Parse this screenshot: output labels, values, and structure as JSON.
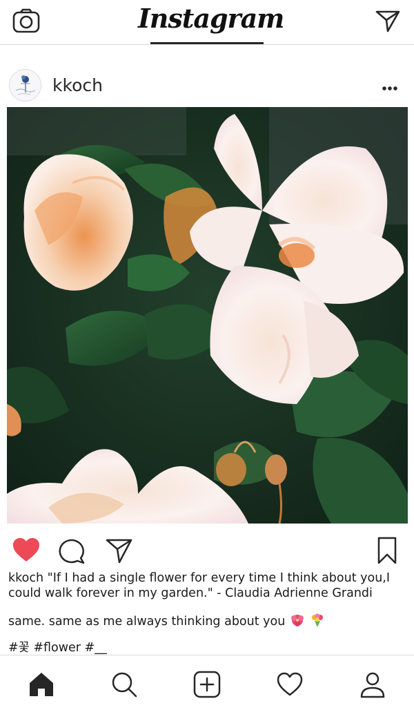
{
  "top_bar": {
    "logo_text": "Instagram",
    "camera_icon": "camera-icon",
    "direct_icon": "paper-plane-icon"
  },
  "post": {
    "username": "kkoch",
    "avatar_icon": "profile-avatar",
    "more_icon": "more-options-icon",
    "photo": "photo of white gardenia flowers with green leaves"
  },
  "actions": {
    "like_icon": "heart-icon",
    "like_color": "#ed4956",
    "comment_icon": "comment-bubble-icon",
    "share_icon": "paper-plane-icon",
    "save_icon": "bookmark-icon"
  },
  "caption": {
    "username": "kkoch",
    "text": "\"If I had a single flower for every time I think about you,I could walk forever in my garden.\" - Claudia Adrienne Grandi"
  },
  "comment": {
    "text": "same. same as me always thinking about you"
  },
  "tags": {
    "text": "#꽃 #flower #__"
  },
  "bottom_nav": {
    "home_icon": "home-icon",
    "search_icon": "search-icon",
    "add_icon": "add-post-icon",
    "activity_icon": "heart-outline-icon",
    "profile_icon": "profile-icon"
  }
}
